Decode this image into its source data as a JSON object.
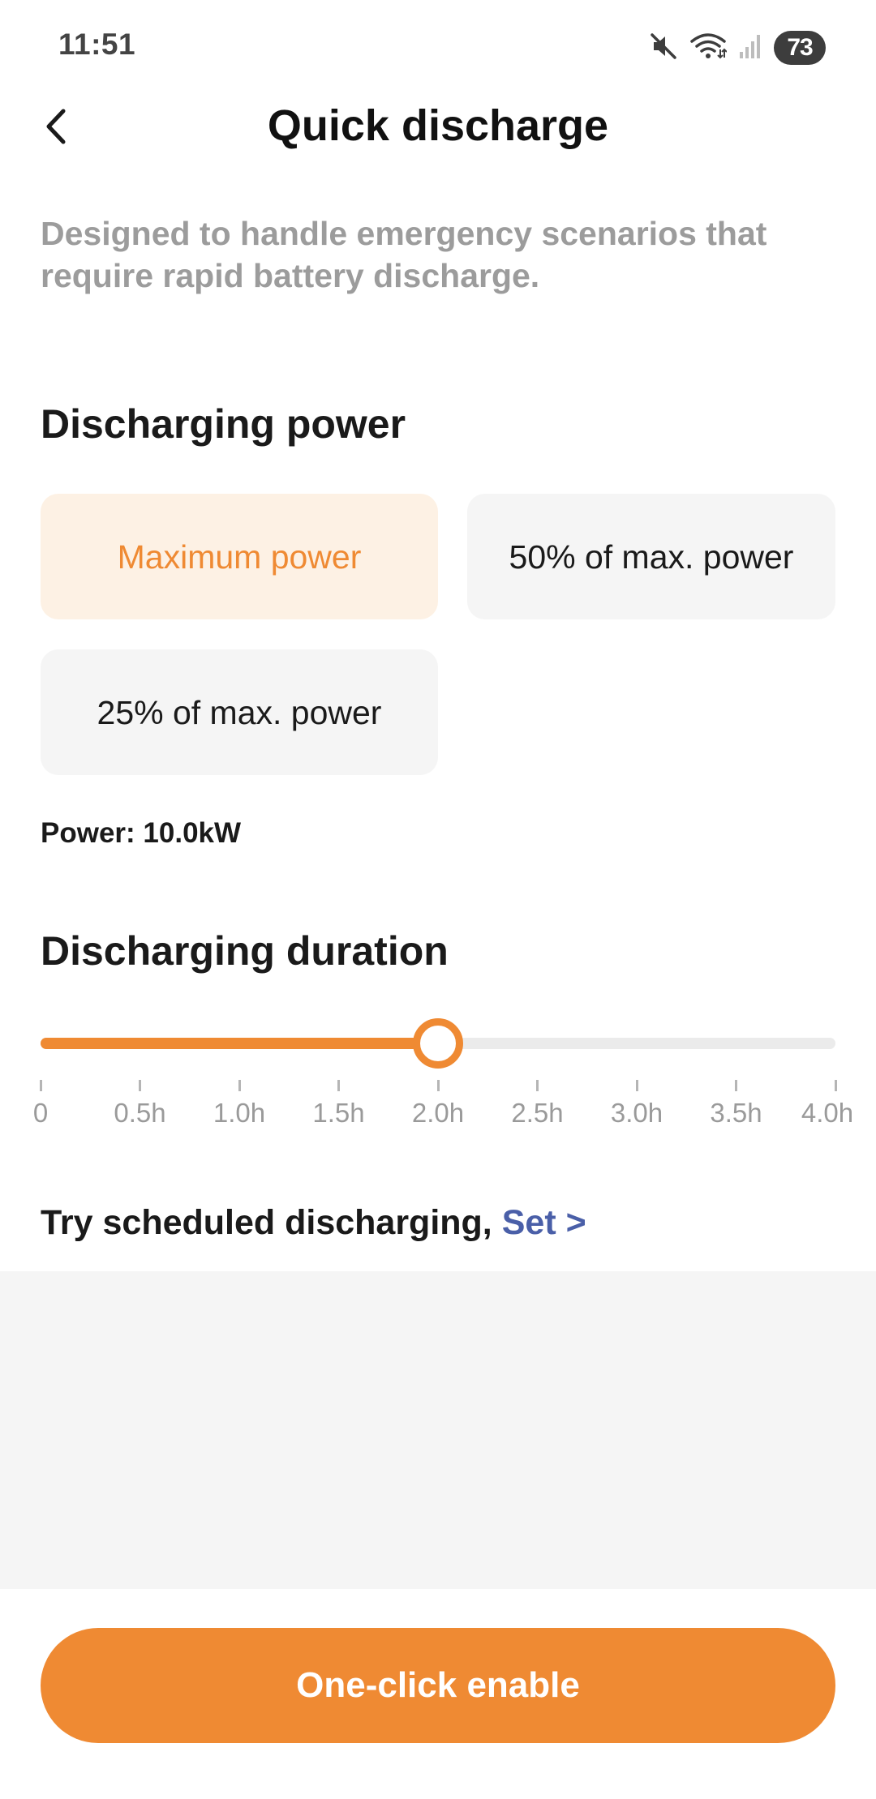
{
  "status_bar": {
    "time": "11:51",
    "battery": "73",
    "icons": [
      "mute-icon",
      "wifi-icon",
      "signal-icon"
    ]
  },
  "header": {
    "title": "Quick discharge",
    "back_icon": "chevron-left-icon"
  },
  "description": "Designed to handle emergency scenarios that require rapid battery discharge.",
  "power_section": {
    "title": "Discharging power",
    "options": [
      {
        "label": "Maximum power",
        "selected": true
      },
      {
        "label": "50% of max. power",
        "selected": false
      },
      {
        "label": "25% of max. power",
        "selected": false
      }
    ],
    "readout": "Power: 10.0kW"
  },
  "duration_section": {
    "title": "Discharging duration",
    "ticks": [
      "0",
      "0.5h",
      "1.0h",
      "1.5h",
      "2.0h",
      "2.5h",
      "3.0h",
      "3.5h",
      "4.0h"
    ],
    "value_hours": 2.0,
    "max_hours": 4.0
  },
  "scheduled": {
    "text": "Try scheduled discharging,",
    "link": "Set >"
  },
  "primary_button": "One-click enable",
  "colors": {
    "accent": "#ef8a33",
    "selected_bg": "#fdf1e4",
    "link": "#4a5fa8"
  }
}
